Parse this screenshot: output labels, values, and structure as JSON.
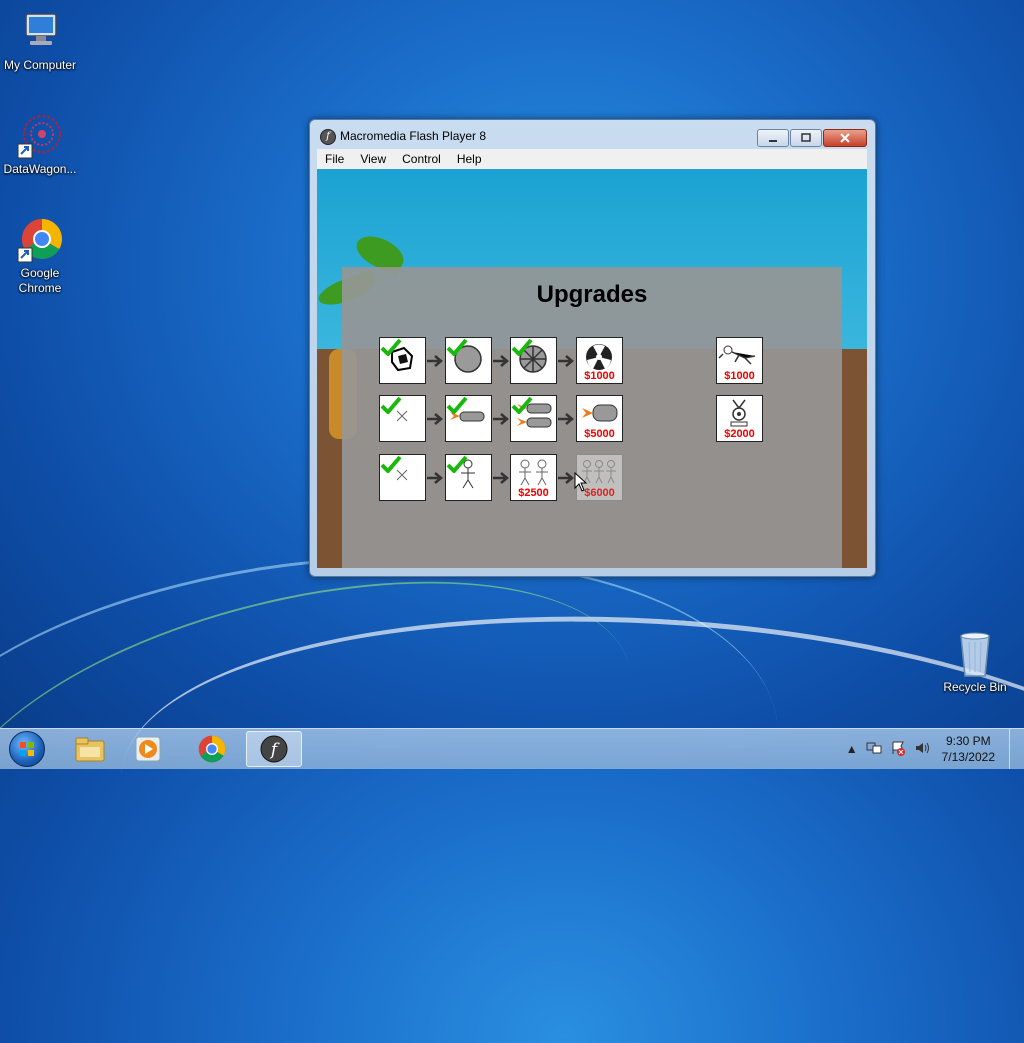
{
  "desktop": {
    "icons": [
      {
        "label": "My Computer"
      },
      {
        "label": "DataWagon..."
      },
      {
        "label": "Google\nChrome"
      },
      {
        "label": "Recycle Bin"
      }
    ]
  },
  "window": {
    "title": "Macromedia Flash Player 8",
    "menu": [
      "File",
      "View",
      "Control",
      "Help"
    ]
  },
  "game": {
    "heading": "Upgrades",
    "prices": {
      "r1c4": "$1000",
      "r2c4": "$5000",
      "r3c3": "$2500",
      "r3c4": "$6000",
      "side1": "$1000",
      "side2": "$2000"
    }
  },
  "taskbar": {
    "time": "9:30 PM",
    "date": "7/13/2022"
  },
  "colors": {
    "price": "#e00000",
    "check": "#19b90b"
  }
}
